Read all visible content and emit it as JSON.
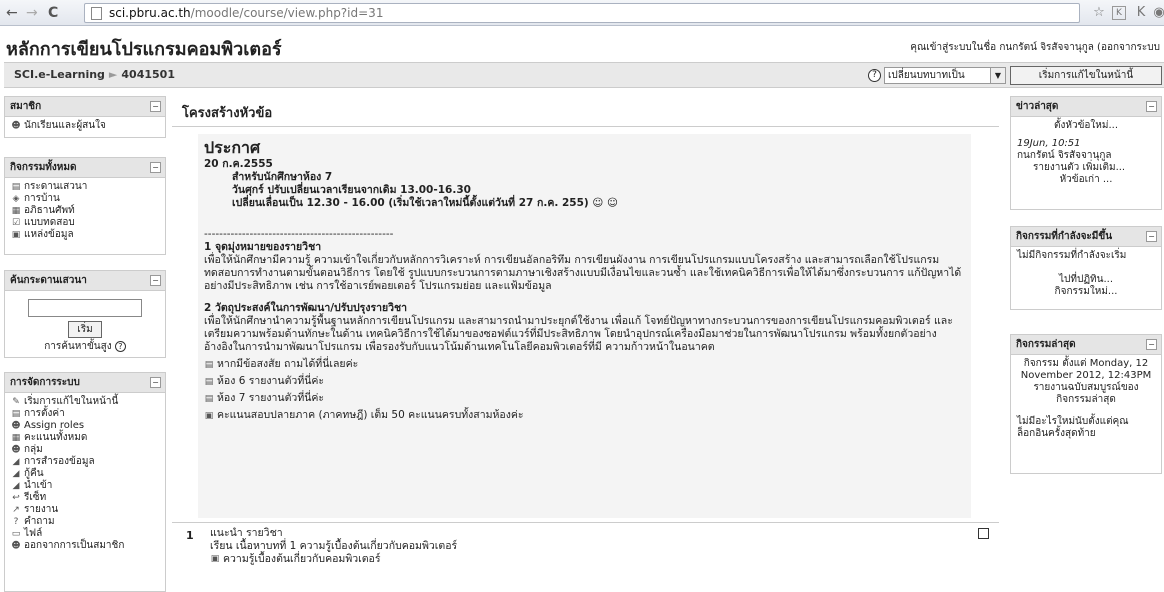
{
  "browser": {
    "url_host": "sci.pbru.ac.th",
    "url_path": "/moodle/course/view.php?id=31"
  },
  "header": {
    "site_title": "หลักการเขียนโปรแกรมคอมพิวเตอร์",
    "login_info": "คุณเข้าสู่ระบบในชื่อ กนกรัตน์ จิรสัจจานุกูล (ออกจากระบบ",
    "breadcrumb": [
      "SCI.e-Learning",
      "4041501"
    ],
    "role_select": "เปลี่ยนบทบาทเป็น",
    "edit_button": "เริ่มการแก้ไขในหน้านี้"
  },
  "left": {
    "members": {
      "title": "สมาชิก",
      "items": [
        {
          "icon": "people-icon",
          "label": "นักเรียนและผู้สนใจ"
        }
      ]
    },
    "activities": {
      "title": "กิจกรรมทั้งหมด",
      "items": [
        {
          "icon": "forum-icon",
          "label": "กระดานเสวนา"
        },
        {
          "icon": "assignment-icon",
          "label": "การบ้าน"
        },
        {
          "icon": "glossary-icon",
          "label": "อภิธานศัพท์"
        },
        {
          "icon": "quiz-icon",
          "label": "แบบทดสอบ"
        },
        {
          "icon": "resource-icon",
          "label": "แหล่งข้อมูล"
        }
      ]
    },
    "search": {
      "title": "ค้นกระดานเสวนา",
      "button": "เริ่ม",
      "advanced": "การค้นหาขั้นสูง"
    },
    "admin": {
      "title": "การจัดการระบบ",
      "items": [
        {
          "icon": "edit-icon",
          "label": "เริ่มการแก้ไขในหน้านี้"
        },
        {
          "icon": "settings-icon",
          "label": "การตั้งค่า"
        },
        {
          "icon": "roles-icon",
          "label": "Assign roles"
        },
        {
          "icon": "grades-icon",
          "label": "คะแนนทั้งหมด"
        },
        {
          "icon": "group-icon",
          "label": "กลุ่ม"
        },
        {
          "icon": "backup-icon",
          "label": "การสำรองข้อมูล"
        },
        {
          "icon": "restore-icon",
          "label": "กู้คืน"
        },
        {
          "icon": "import-icon",
          "label": "นำเข้า"
        },
        {
          "icon": "reset-icon",
          "label": "รีเซ็ท"
        },
        {
          "icon": "report-icon",
          "label": "รายงาน"
        },
        {
          "icon": "question-icon",
          "label": "คำถาม"
        },
        {
          "icon": "files-icon",
          "label": "ไฟล์"
        },
        {
          "icon": "unenrol-icon",
          "label": "ออกจากการเป็นสมาชิก"
        }
      ]
    }
  },
  "main": {
    "heading": "โครงสร้างหัวข้อ",
    "announce_title": "ประกาศ",
    "announce_date": "20 ก.ค.2555",
    "announce_l1": "สำหรับนักศึกษาห้อง 7",
    "announce_l2": "วันศุกร์ ปรับเปลี่ยนเวลาเรียนจากเดิม 13.00-16.30",
    "announce_l3": "เปลี่ยนเลื่อนเป็น 12.30 - 16.00  (เริ่มใช้เวลาใหม่นี้ตั้งแต่วันที่ 27 ก.ค. 255) ☺ ☺",
    "dashes": "--------------------------------------------------",
    "obj1_title": "1 จุดมุ่งหมายของรายวิชา",
    "obj1_text": "เพื่อให้นักศึกษามีความรู้ ความเข้าใจเกี่ยวกับหลักการวิเคราะห์ การเขียนอัลกอริทึม การเขียนผังงาน การเขียนโปรแกรมแบบโครงสร้าง และสามารถเลือกใช้โปรแกรมทดสอบการทำงานตามขั้นตอนวิธีการ โดยใช้ รูปแบบกระบวนการตามภาษาเชิงสร้างแบบมีเงื่อนไขและวนซ้ำ และใช้เทคนิควิธีการเพื่อให้ได้มาซึ่งกระบวนการ แก้ปัญหาได้อย่างมีประสิทธิภาพ เช่น การใช้อาเรย์พอยเตอร์ โปรแกรมย่อย และแฟ้มข้อมูล",
    "obj2_title": "2 วัตถุประสงค์ในการพัฒนา/ปรับปรุงรายวิชา",
    "obj2_text": "เพื่อให้นักศึกษานำความรู้พื้นฐานหลักการเขียนโปรแกรม และสามารถนำมาประยุกต์ใช้งาน เพื่อแก้ โจทย์ปัญหาทางกระบวนการของการเขียนโปรแกรมคอมพิวเตอร์ และเตรียมความพร้อมด้านทักษะในด้าน เทคนิควิธีการใช้ได้มาของซอฟต์แวร์ที่มีประสิทธิภาพ โดยนำอุปกรณ์เครื่องมือมาช่วยในการพัฒนาโปรแกรม พร้อมทั้งยกตัวอย่างอ้างอิงในการนำมาพัฒนาโปรแกรม เพื่อรองรับกับแนวโน้มด้านเทคโนโลยีคอมพิวเตอร์ที่มี ความก้าวหน้าในอนาคต",
    "resources": [
      {
        "icon": "forum-icon",
        "label": "หากมีข้อสงสัย ถามได้ที่นี่เลยค่ะ"
      },
      {
        "icon": "forum-icon",
        "label": "ห้อง 6 รายงานตัวที่นี่ค่ะ"
      },
      {
        "icon": "forum-icon",
        "label": "ห้อง 7 รายงานตัวที่นี่ค่ะ"
      },
      {
        "icon": "document-icon",
        "label": "คะแนนสอบปลายภาค (ภาคทษฎี) เต็ม 50 คะแนนครบทั้งสามห้องค่ะ"
      }
    ],
    "sec1_num": "1",
    "sec1_title": "แนะนำ รายวิชา",
    "sec1_line": "เรียน เนื้อหาบทที่ 1 ความรู้เบื้องต้นเกี่ยวกับคอมพิวเตอร์",
    "sec1_res": "ความรู้เบื้องต้นเกี่ยวกับคอมพิวเตอร์"
  },
  "right": {
    "news": {
      "title": "ข่าวล่าสุด",
      "add": "ตั้งหัวข้อใหม่...",
      "date": "19Jun, 10:51",
      "author": "กนกรัตน์ จิรสัจจานุกูล",
      "text": "รายงานตัว เพิ่มเติม...",
      "older": "หัวข้อเก่า ..."
    },
    "upcoming": {
      "title": "กิจกรรมที่กำลังจะมีขึ้น",
      "none": "ไม่มีกิจกรรมที่กำลังจะเริ่ม",
      "calendar": "ไปที่ปฏิทิน...",
      "new_event": "กิจกรรมใหม่..."
    },
    "recent": {
      "title": "กิจกรรมล่าสุด",
      "since": "กิจกรรม ตั้งแต่ Monday, 12 November 2012, 12:43PM",
      "full_report": "รายงานฉบับสมบูรณ์ของกิจกรรมล่าสุด",
      "nothing": "ไม่มีอะไรใหม่นับตั้งแต่คุณล็อกอินครั้งสุดท้าย"
    }
  }
}
